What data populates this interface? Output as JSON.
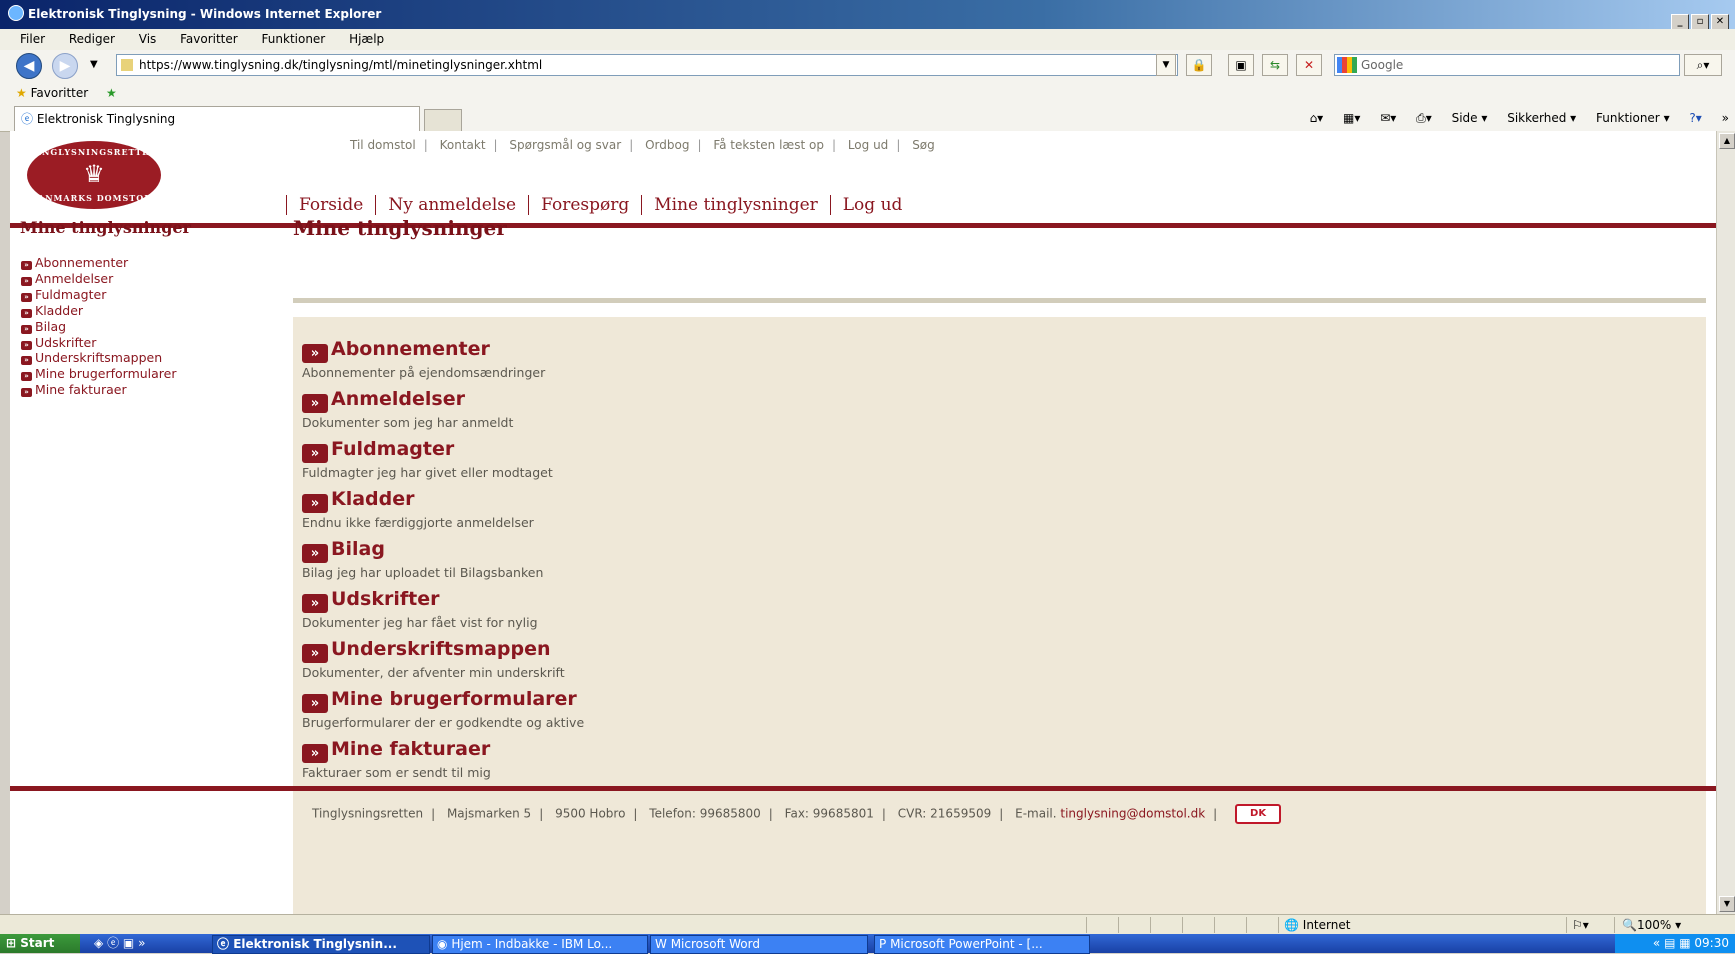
{
  "window": {
    "title": "Elektronisk Tinglysning - Windows Internet Explorer"
  },
  "menu": [
    "Filer",
    "Rediger",
    "Vis",
    "Favoritter",
    "Funktioner",
    "Hjælp"
  ],
  "address": {
    "url": "https://www.tinglysning.dk/tinglysning/mtl/minetinglysninger.xhtml"
  },
  "search": {
    "placeholder": "Google"
  },
  "favorites": {
    "label": "Favoritter"
  },
  "tab": {
    "label": "Elektronisk Tinglysning"
  },
  "commandbar": {
    "side": "Side",
    "sikkerhed": "Sikkerhed",
    "funktioner": "Funktioner"
  },
  "logo": {
    "top": "TINGLYSNINGSRETTEN",
    "bottom": "DANMARKS DOMSTOLE"
  },
  "toplinks": [
    "Til domstol",
    "Kontakt",
    "Spørgsmål og svar",
    "Ordbog",
    "Få teksten læst op",
    "Log ud",
    "Søg"
  ],
  "mainnav": [
    "Forside",
    "Ny anmeldelse",
    "Forespørg",
    "Mine tinglysninger",
    "Log ud"
  ],
  "sidebar": {
    "title": "Mine tinglysninger",
    "items": [
      "Abonnementer",
      "Anmeldelser",
      "Fuldmagter",
      "Kladder",
      "Bilag",
      "Udskrifter",
      "Underskriftsmappen",
      "Mine brugerformularer",
      "Mine fakturaer"
    ]
  },
  "page": {
    "title": "Mine tinglysninger",
    "items": [
      {
        "title": "Abonnementer",
        "desc": "Abonnementer på ejendomsændringer"
      },
      {
        "title": "Anmeldelser",
        "desc": "Dokumenter som jeg har anmeldt"
      },
      {
        "title": "Fuldmagter",
        "desc": "Fuldmagter jeg har givet eller modtaget"
      },
      {
        "title": "Kladder",
        "desc": "Endnu ikke færdiggjorte anmeldelser"
      },
      {
        "title": "Bilag",
        "desc": "Bilag jeg har uploadet til Bilagsbanken"
      },
      {
        "title": "Udskrifter",
        "desc": "Dokumenter jeg har fået vist for nylig"
      },
      {
        "title": "Underskriftsmappen",
        "desc": "Dokumenter, der afventer min underskrift"
      },
      {
        "title": "Mine brugerformularer",
        "desc": "Brugerformularer der er godkendte og aktive"
      },
      {
        "title": "Mine fakturaer",
        "desc": "Fakturaer som er sendt til mig"
      }
    ]
  },
  "footer": {
    "items": [
      "Tinglysningsretten",
      "Majsmarken 5",
      "9500 Hobro",
      "Telefon: 99685800",
      "Fax: 99685801",
      "CVR: 21659509"
    ],
    "email_prefix": "E-mail.",
    "email": "tinglysning@domstol.dk",
    "logo_text": "DK"
  },
  "status": {
    "zone": "Internet",
    "zoom": "100%"
  },
  "taskbar": {
    "start": "Start",
    "tasks": [
      "Elektronisk Tinglysnin...",
      "Hjem - Indbakke - IBM Lo...",
      "Microsoft Word",
      "Microsoft PowerPoint - [..."
    ],
    "clock": "09:30"
  }
}
